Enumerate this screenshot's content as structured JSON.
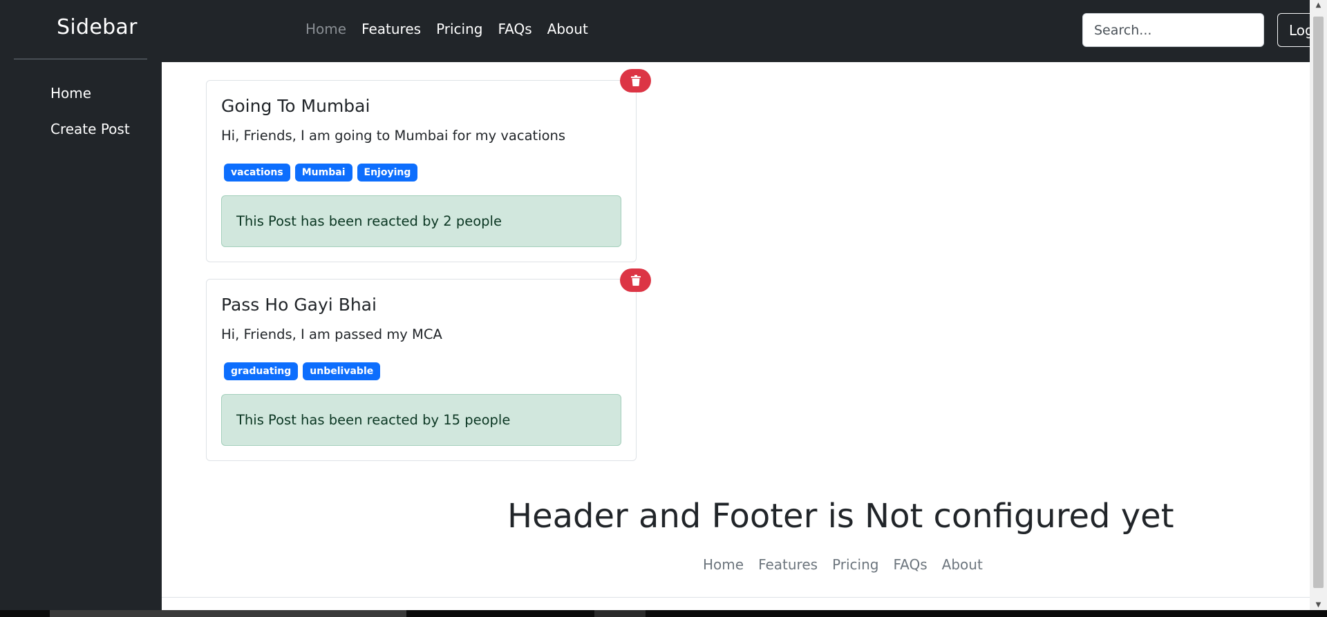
{
  "sidebar": {
    "title": "Sidebar",
    "items": [
      {
        "label": "Home"
      },
      {
        "label": "Create Post"
      }
    ]
  },
  "topnav": {
    "items": [
      {
        "label": "Home",
        "active": true
      },
      {
        "label": "Features"
      },
      {
        "label": "Pricing"
      },
      {
        "label": "FAQs"
      },
      {
        "label": "About"
      }
    ],
    "search_placeholder": "Search...",
    "login_label": "Login"
  },
  "posts": [
    {
      "title": "Going To Mumbai",
      "body": "Hi, Friends, I am going to Mumbai for my vacations",
      "tags": [
        "vacations",
        "Mumbai",
        "Enjoying"
      ],
      "reaction_text": "This Post has been reacted by 2 people"
    },
    {
      "title": "Pass Ho Gayi Bhai",
      "body": "Hi, Friends, I am passed my MCA",
      "tags": [
        "graduating",
        "unbelivable"
      ],
      "reaction_text": "This Post has been reacted by 15 people"
    }
  ],
  "welcome": {
    "heading": "Header and Footer is Not configured yet"
  },
  "footer": {
    "items": [
      {
        "label": "Home"
      },
      {
        "label": "Features"
      },
      {
        "label": "Pricing"
      },
      {
        "label": "FAQs"
      },
      {
        "label": "About"
      }
    ]
  },
  "colors": {
    "dark_bg": "#212529",
    "primary": "#0d6efd",
    "danger": "#dc3545",
    "success_bg": "#d1e7dd"
  }
}
